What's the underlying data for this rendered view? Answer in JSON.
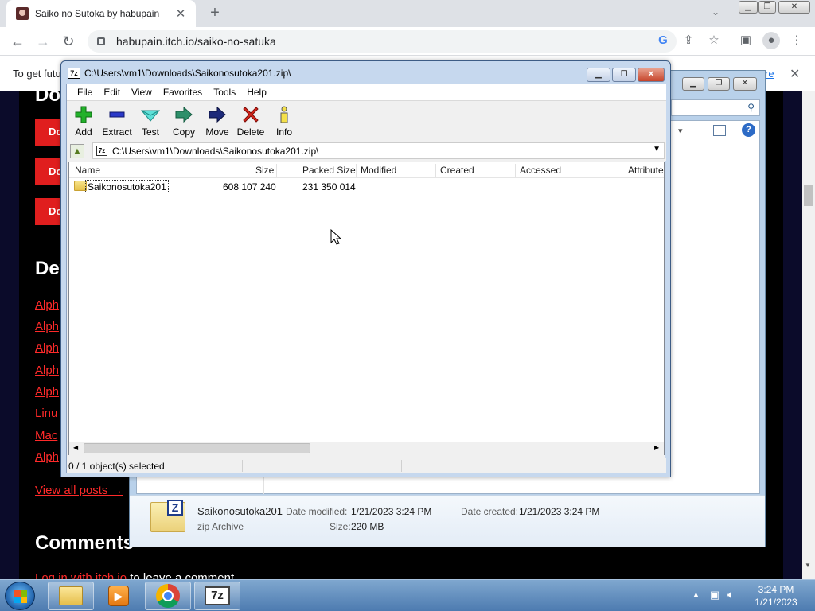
{
  "browser": {
    "tab_title": "Saiko no Sutoka by habupain",
    "tab_close": "✕",
    "new_tab": "+",
    "url": "habupain.itch.io/saiko-no-satuka",
    "infobar_text": "To get futu",
    "infobar_link": "re",
    "infobar_close": "✕"
  },
  "page": {
    "download_heading": "Do",
    "download_buttons": [
      "Do",
      "Do",
      "Do"
    ],
    "devlog_heading": "Dev",
    "devlog_links": [
      "Alph",
      "Alph",
      "Alph",
      "Alph",
      "Alph",
      "Linu",
      "Mac",
      "Alph"
    ],
    "view_all": "View all posts →",
    "comments_heading": "Comments",
    "login_link": "Log in with itch.io",
    "login_rest": " to leave a comment."
  },
  "explorer_details": {
    "name": "Saikonosutoka201",
    "type": "zip Archive",
    "modified_label": "Date modified:",
    "modified_value": "1/21/2023 3:24 PM",
    "created_label": "Date created:",
    "created_value": "1/21/2023 3:24 PM",
    "size_label": "Size:",
    "size_value": "220 MB"
  },
  "sevenzip": {
    "title": "C:\\Users\\vm1\\Downloads\\Saikonosutoka201.zip\\",
    "menu": [
      "File",
      "Edit",
      "View",
      "Favorites",
      "Tools",
      "Help"
    ],
    "toolbar": [
      "Add",
      "Extract",
      "Test",
      "Copy",
      "Move",
      "Delete",
      "Info"
    ],
    "path": "C:\\Users\\vm1\\Downloads\\Saikonosutoka201.zip\\",
    "columns": [
      "Name",
      "Size",
      "Packed Size",
      "Modified",
      "Created",
      "Accessed",
      "Attribute"
    ],
    "rows": [
      {
        "name": "Saikonosutoka201",
        "size": "608 107 240",
        "packed": "231 350 014"
      }
    ],
    "status": "0 / 1 object(s) selected"
  },
  "taskbar": {
    "time": "3:24 PM",
    "date": "1/21/2023",
    "app_7z": "7z"
  }
}
